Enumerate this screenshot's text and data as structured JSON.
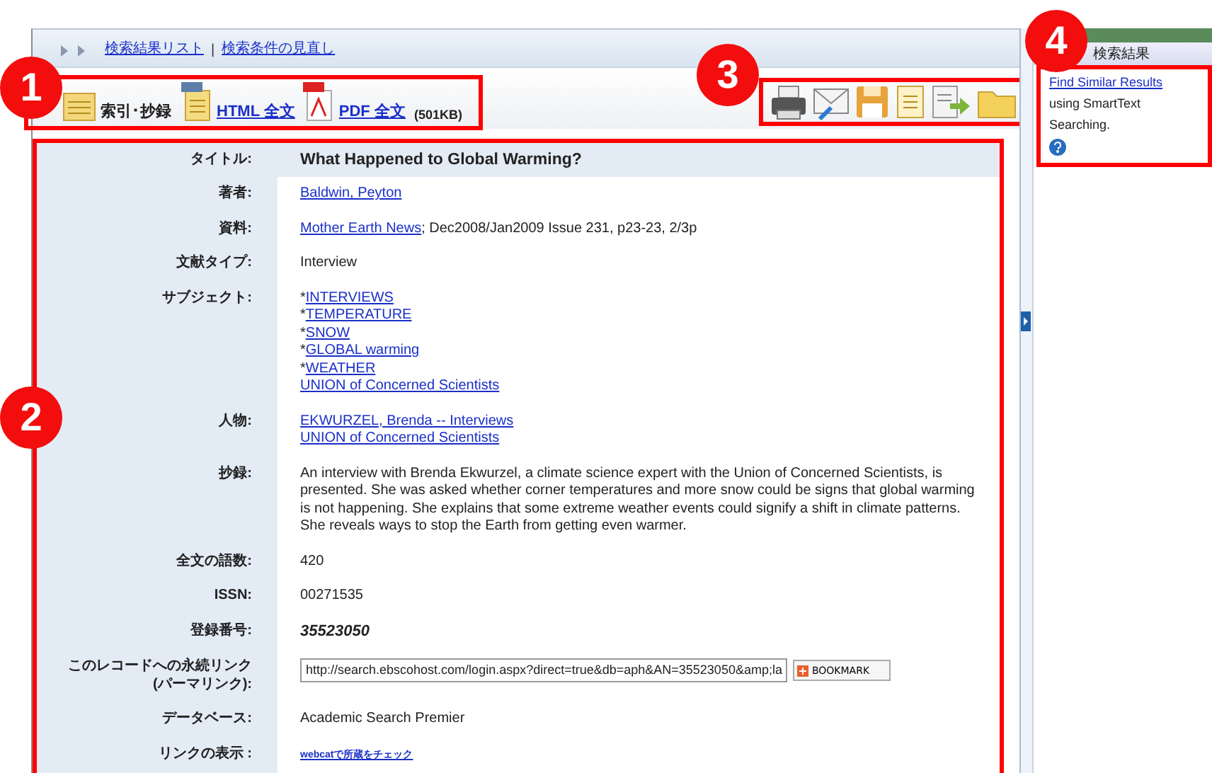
{
  "breadcrumb": {
    "links": [
      "検索結果リスト",
      "検索条件の見直し"
    ],
    "separator": "|"
  },
  "format_links": [
    {
      "kind": "citation",
      "label": "索引･抄録"
    },
    {
      "kind": "html",
      "label": "HTML 全文"
    },
    {
      "kind": "pdf",
      "label": "PDF 全文",
      "size": "(501KB)"
    }
  ],
  "tools": [
    {
      "kind": "print"
    },
    {
      "kind": "email"
    },
    {
      "kind": "save"
    },
    {
      "kind": "cite"
    },
    {
      "kind": "export"
    },
    {
      "kind": "folder"
    }
  ],
  "record": {
    "fields": [
      {
        "kind": "title",
        "label": "タイトル:",
        "value": "What Happened to Global Warming?"
      },
      {
        "kind": "links",
        "label": "著者:",
        "links": [
          "Baldwin, Peyton"
        ]
      },
      {
        "kind": "source",
        "label": "資料:",
        "link": "Mother Earth News",
        "text": "; Dec2008/Jan2009 Issue 231, p23-23, 2/3p"
      },
      {
        "kind": "text",
        "label": "文献タイプ:",
        "value": "Interview"
      },
      {
        "kind": "subjects",
        "label": "サブジェクト:",
        "items": [
          {
            "mark": "*",
            "link": "INTERVIEWS"
          },
          {
            "mark": "*",
            "link": "TEMPERATURE"
          },
          {
            "mark": "*",
            "link": "SNOW"
          },
          {
            "mark": "*",
            "link": "GLOBAL warming"
          },
          {
            "mark": "*",
            "link": "WEATHER"
          },
          {
            "link": "UNION of Concerned Scientists"
          }
        ]
      },
      {
        "kind": "links",
        "label": "人物:",
        "links": [
          "EKWURZEL, Brenda -- Interviews",
          "UNION of Concerned Scientists"
        ]
      },
      {
        "kind": "text",
        "label": "抄録:",
        "value": "An interview with Brenda Ekwurzel, a climate science expert with the Union of Concerned Scientists, is presented. She was asked whether corner temperatures and more snow could be signs that global warming is not happening. She explains that some extreme weather events could signify a shift in climate patterns. She reveals ways to stop the Earth from getting even warmer."
      },
      {
        "kind": "text",
        "label": "全文の語数:",
        "value": "420"
      },
      {
        "kind": "text",
        "label": "ISSN:",
        "value": "00271535"
      },
      {
        "kind": "accession",
        "label": "登録番号:",
        "value": "35523050"
      },
      {
        "kind": "permalink",
        "label": "このレコードへの永続リンク (パーマリンク):",
        "value": "http://search.ebscohost.com/login.aspx?direct=true&db=aph&AN=35523050&amp;la",
        "bookmark": "BOOKMARK"
      },
      {
        "kind": "text",
        "label": "データベース:",
        "value": "Academic Search Premier"
      },
      {
        "kind": "smalllink",
        "label": "リンクの表示 :",
        "value": "webcatで所蔵をチェック"
      }
    ]
  },
  "related": {
    "title": "検索結果",
    "link": "Find Similar Results",
    "text": " using SmartText Searching."
  },
  "annotations": [
    {
      "label": "1"
    },
    {
      "label": "2"
    },
    {
      "label": "3"
    },
    {
      "label": "4"
    }
  ]
}
